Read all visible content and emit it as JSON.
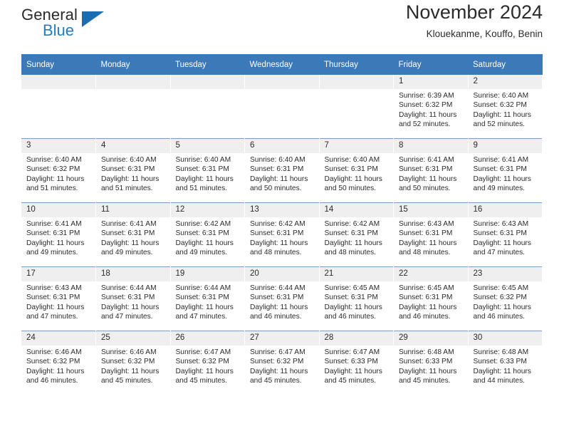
{
  "logo": {
    "word_top": "General",
    "word_bottom": "Blue",
    "accent_color": "#1b6cb0"
  },
  "header": {
    "title": "November 2024",
    "subtitle": "Klouekanme, Kouffo, Benin",
    "header_bg_color": "#3b79b8",
    "daynum_bg_color": "#efefef"
  },
  "weekdays": [
    "Sunday",
    "Monday",
    "Tuesday",
    "Wednesday",
    "Thursday",
    "Friday",
    "Saturday"
  ],
  "labels": {
    "sunrise": "Sunrise:",
    "sunset": "Sunset:",
    "daylight": "Daylight:"
  },
  "weeks": [
    [
      {
        "day": "",
        "empty": true
      },
      {
        "day": "",
        "empty": true
      },
      {
        "day": "",
        "empty": true
      },
      {
        "day": "",
        "empty": true
      },
      {
        "day": "",
        "empty": true
      },
      {
        "day": "1",
        "sunrise": "Sunrise: 6:39 AM",
        "sunset": "Sunset: 6:32 PM",
        "daylight": "Daylight: 11 hours and 52 minutes."
      },
      {
        "day": "2",
        "sunrise": "Sunrise: 6:40 AM",
        "sunset": "Sunset: 6:32 PM",
        "daylight": "Daylight: 11 hours and 52 minutes."
      }
    ],
    [
      {
        "day": "3",
        "sunrise": "Sunrise: 6:40 AM",
        "sunset": "Sunset: 6:32 PM",
        "daylight": "Daylight: 11 hours and 51 minutes."
      },
      {
        "day": "4",
        "sunrise": "Sunrise: 6:40 AM",
        "sunset": "Sunset: 6:31 PM",
        "daylight": "Daylight: 11 hours and 51 minutes."
      },
      {
        "day": "5",
        "sunrise": "Sunrise: 6:40 AM",
        "sunset": "Sunset: 6:31 PM",
        "daylight": "Daylight: 11 hours and 51 minutes."
      },
      {
        "day": "6",
        "sunrise": "Sunrise: 6:40 AM",
        "sunset": "Sunset: 6:31 PM",
        "daylight": "Daylight: 11 hours and 50 minutes."
      },
      {
        "day": "7",
        "sunrise": "Sunrise: 6:40 AM",
        "sunset": "Sunset: 6:31 PM",
        "daylight": "Daylight: 11 hours and 50 minutes."
      },
      {
        "day": "8",
        "sunrise": "Sunrise: 6:41 AM",
        "sunset": "Sunset: 6:31 PM",
        "daylight": "Daylight: 11 hours and 50 minutes."
      },
      {
        "day": "9",
        "sunrise": "Sunrise: 6:41 AM",
        "sunset": "Sunset: 6:31 PM",
        "daylight": "Daylight: 11 hours and 49 minutes."
      }
    ],
    [
      {
        "day": "10",
        "sunrise": "Sunrise: 6:41 AM",
        "sunset": "Sunset: 6:31 PM",
        "daylight": "Daylight: 11 hours and 49 minutes."
      },
      {
        "day": "11",
        "sunrise": "Sunrise: 6:41 AM",
        "sunset": "Sunset: 6:31 PM",
        "daylight": "Daylight: 11 hours and 49 minutes."
      },
      {
        "day": "12",
        "sunrise": "Sunrise: 6:42 AM",
        "sunset": "Sunset: 6:31 PM",
        "daylight": "Daylight: 11 hours and 49 minutes."
      },
      {
        "day": "13",
        "sunrise": "Sunrise: 6:42 AM",
        "sunset": "Sunset: 6:31 PM",
        "daylight": "Daylight: 11 hours and 48 minutes."
      },
      {
        "day": "14",
        "sunrise": "Sunrise: 6:42 AM",
        "sunset": "Sunset: 6:31 PM",
        "daylight": "Daylight: 11 hours and 48 minutes."
      },
      {
        "day": "15",
        "sunrise": "Sunrise: 6:43 AM",
        "sunset": "Sunset: 6:31 PM",
        "daylight": "Daylight: 11 hours and 48 minutes."
      },
      {
        "day": "16",
        "sunrise": "Sunrise: 6:43 AM",
        "sunset": "Sunset: 6:31 PM",
        "daylight": "Daylight: 11 hours and 47 minutes."
      }
    ],
    [
      {
        "day": "17",
        "sunrise": "Sunrise: 6:43 AM",
        "sunset": "Sunset: 6:31 PM",
        "daylight": "Daylight: 11 hours and 47 minutes."
      },
      {
        "day": "18",
        "sunrise": "Sunrise: 6:44 AM",
        "sunset": "Sunset: 6:31 PM",
        "daylight": "Daylight: 11 hours and 47 minutes."
      },
      {
        "day": "19",
        "sunrise": "Sunrise: 6:44 AM",
        "sunset": "Sunset: 6:31 PM",
        "daylight": "Daylight: 11 hours and 47 minutes."
      },
      {
        "day": "20",
        "sunrise": "Sunrise: 6:44 AM",
        "sunset": "Sunset: 6:31 PM",
        "daylight": "Daylight: 11 hours and 46 minutes."
      },
      {
        "day": "21",
        "sunrise": "Sunrise: 6:45 AM",
        "sunset": "Sunset: 6:31 PM",
        "daylight": "Daylight: 11 hours and 46 minutes."
      },
      {
        "day": "22",
        "sunrise": "Sunrise: 6:45 AM",
        "sunset": "Sunset: 6:31 PM",
        "daylight": "Daylight: 11 hours and 46 minutes."
      },
      {
        "day": "23",
        "sunrise": "Sunrise: 6:45 AM",
        "sunset": "Sunset: 6:32 PM",
        "daylight": "Daylight: 11 hours and 46 minutes."
      }
    ],
    [
      {
        "day": "24",
        "sunrise": "Sunrise: 6:46 AM",
        "sunset": "Sunset: 6:32 PM",
        "daylight": "Daylight: 11 hours and 46 minutes."
      },
      {
        "day": "25",
        "sunrise": "Sunrise: 6:46 AM",
        "sunset": "Sunset: 6:32 PM",
        "daylight": "Daylight: 11 hours and 45 minutes."
      },
      {
        "day": "26",
        "sunrise": "Sunrise: 6:47 AM",
        "sunset": "Sunset: 6:32 PM",
        "daylight": "Daylight: 11 hours and 45 minutes."
      },
      {
        "day": "27",
        "sunrise": "Sunrise: 6:47 AM",
        "sunset": "Sunset: 6:32 PM",
        "daylight": "Daylight: 11 hours and 45 minutes."
      },
      {
        "day": "28",
        "sunrise": "Sunrise: 6:47 AM",
        "sunset": "Sunset: 6:33 PM",
        "daylight": "Daylight: 11 hours and 45 minutes."
      },
      {
        "day": "29",
        "sunrise": "Sunrise: 6:48 AM",
        "sunset": "Sunset: 6:33 PM",
        "daylight": "Daylight: 11 hours and 45 minutes."
      },
      {
        "day": "30",
        "sunrise": "Sunrise: 6:48 AM",
        "sunset": "Sunset: 6:33 PM",
        "daylight": "Daylight: 11 hours and 44 minutes."
      }
    ]
  ]
}
